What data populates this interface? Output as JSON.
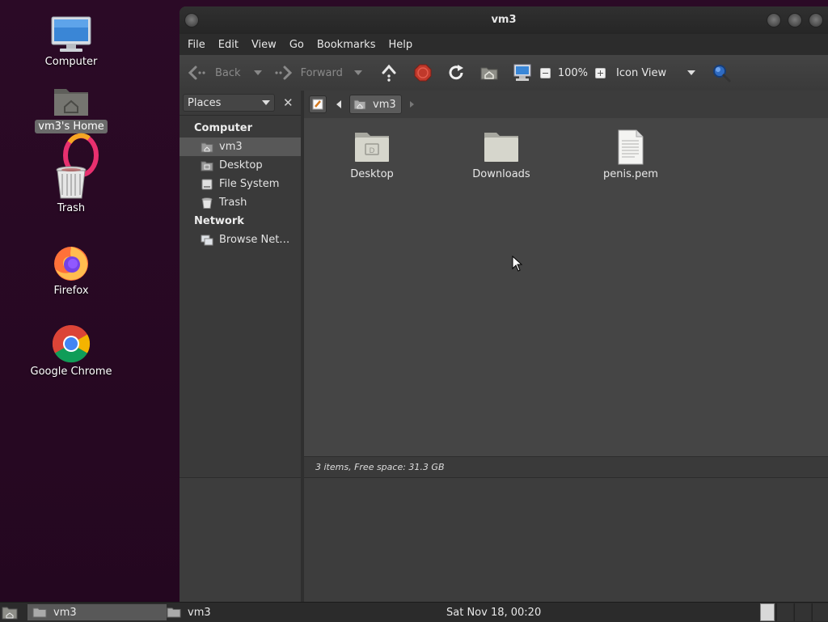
{
  "desktop": {
    "icons": [
      {
        "label": "Computer",
        "icon": "computer-icon"
      },
      {
        "label": "vm3's Home",
        "icon": "home-folder-icon",
        "selected": true
      },
      {
        "label": "Trash",
        "icon": "trash-icon"
      },
      {
        "label": "Firefox",
        "icon": "firefox-icon"
      },
      {
        "label": "Google Chrome",
        "icon": "chrome-icon"
      }
    ]
  },
  "window": {
    "title": "vm3",
    "menu": [
      "File",
      "Edit",
      "View",
      "Go",
      "Bookmarks",
      "Help"
    ],
    "toolbar": {
      "back": "Back",
      "forward": "Forward",
      "zoom": "100%",
      "view_mode": "Icon View",
      "icons": [
        "back-arrow-icon",
        "forward-arrow-icon",
        "up-icon",
        "stop-icon",
        "reload-icon",
        "home-icon",
        "computer-icon",
        "zoom-out-icon",
        "zoom-in-icon",
        "search-icon"
      ]
    },
    "sidebar": {
      "header": "Places",
      "sections": [
        {
          "title": "Computer",
          "items": [
            {
              "label": "vm3",
              "icon": "home-icon",
              "selected": true
            },
            {
              "label": "Desktop",
              "icon": "desktop-folder-icon"
            },
            {
              "label": "File System",
              "icon": "drive-icon"
            },
            {
              "label": "Trash",
              "icon": "trash-icon"
            }
          ]
        },
        {
          "title": "Network",
          "items": [
            {
              "label": "Browse Net…",
              "icon": "network-icon"
            }
          ]
        }
      ]
    },
    "pathbar": {
      "current": "vm3"
    },
    "files": [
      {
        "name": "Desktop",
        "icon": "desktop-folder-icon"
      },
      {
        "name": "Downloads",
        "icon": "folder-icon"
      },
      {
        "name": "penis.pem",
        "icon": "text-file-icon"
      }
    ],
    "status": "3 items, Free space: 31.3 GB"
  },
  "taskbar": {
    "tasks": [
      "vm3",
      "vm3"
    ],
    "clock": "Sat Nov 18, 00:20"
  },
  "colors": {
    "desktop_bg": "#2b0a26",
    "window_bg": "#3c3c3c",
    "content_bg": "#454545",
    "stop_red": "#c0392b",
    "firefox_orange": "#ff7139",
    "search_blue": "#3f7fd8"
  }
}
